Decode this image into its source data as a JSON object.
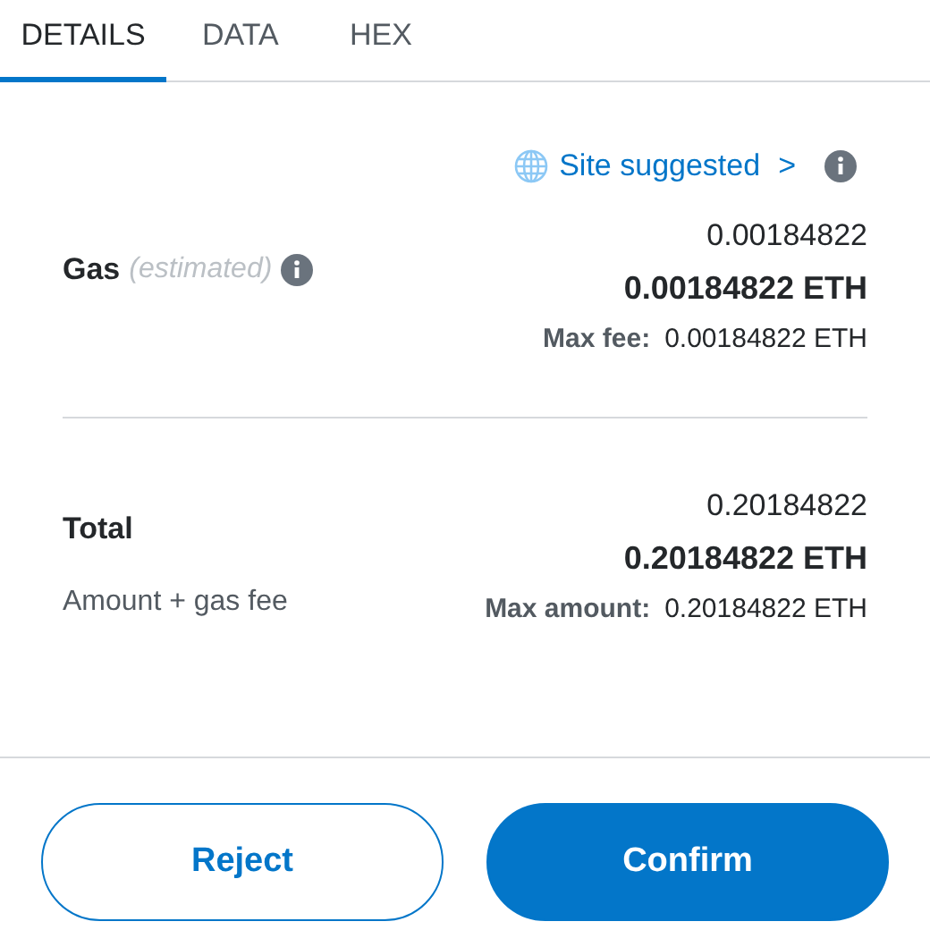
{
  "tabs": [
    {
      "label": "DETAILS",
      "selected": true
    },
    {
      "label": "DATA",
      "selected": false
    },
    {
      "label": "HEX",
      "selected": false
    }
  ],
  "site_suggested": {
    "label": "Site suggested",
    "chevron": ">"
  },
  "gas": {
    "label": "Gas",
    "qualifier": "(estimated)",
    "value": "0.00184822",
    "value_eth": "0.00184822 ETH",
    "max_label": "Max fee:",
    "max_value": "0.00184822 ETH"
  },
  "total": {
    "label": "Total",
    "sublabel": "Amount + gas fee",
    "value": "0.20184822",
    "value_eth": "0.20184822 ETH",
    "max_label": "Max amount:",
    "max_value": "0.20184822 ETH"
  },
  "buttons": [
    {
      "label": "Reject",
      "kind": "secondary"
    },
    {
      "label": "Confirm",
      "kind": "primary"
    }
  ]
}
